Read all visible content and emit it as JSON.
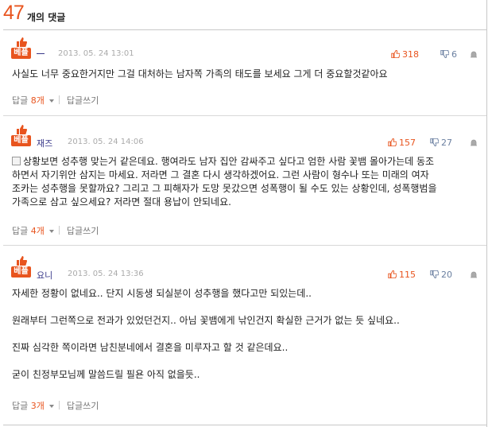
{
  "header": {
    "count": "47",
    "label": "개의 댓글"
  },
  "comments": [
    {
      "badge": "베플",
      "name": "",
      "date": "2013. 05. 24 13:01",
      "up": "318",
      "down": "6",
      "lines": [
        "사실도 너무 중요한거지만 그걸 대처하는 남자쪽 가족의 태도를 보세요 그게 더 중요할것같아요"
      ],
      "reply_label": "답글",
      "reply_count": "8개",
      "write_label": "답글쓰기"
    },
    {
      "badge": "베플",
      "name": "재즈",
      "date": "2013. 05. 24 14:06",
      "up": "157",
      "down": "27",
      "lines": [
        "상황보면 성추행 맞는거 같은데요. 행여라도 남자 집안 감싸주고 싶다고 엄한 사람 꽃뱀 몰아가는데 동조",
        "하면서 자기위안 삼지는 마세요. 저라면 그 결혼 다시 생각하겠어요. 그런 사람이 형수나 또는 미래의 여자",
        "조카는 성추행을 못할까요? 그리고 그 피해자가 도망 못갔으면 성폭행이 될 수도 있는 상황인데, 성폭행범을",
        "가족으로 삼고 싶으세요? 저라면 절대 용납이 안되네요."
      ],
      "reply_label": "답글",
      "reply_count": "4개",
      "write_label": "답글쓰기"
    },
    {
      "badge": "베플",
      "name": "요니",
      "date": "2013. 05. 24 13:36",
      "up": "115",
      "down": "20",
      "lines": [
        "자세한 정황이 없네요.. 단지 시동생 되실분이 성추행을 했다고만 되있는데..",
        "원래부터 그런쪽으로 전과가 있었던건지.. 아님 꽃뱀에게 낚인건지 확실한 근거가 없는 듯 싶네요..",
        "진짜 심각한 쪽이라면 남친분네에서 결혼을 미루자고 할 것 같은데요..",
        "굳이 친정부모님께 말씀드릴 필욘 아직 없을듯.."
      ],
      "reply_label": "답글",
      "reply_count": "3개",
      "write_label": "답글쓰기"
    }
  ],
  "icons": {
    "best": "thumbs-up-icon",
    "up": "thumbs-up-icon",
    "down": "thumbs-down-icon",
    "report": "siren-icon",
    "quote": "document-icon"
  },
  "colors": {
    "accent": "#e8541e",
    "name": "#3a3a8a",
    "down": "#6a7fa0"
  }
}
